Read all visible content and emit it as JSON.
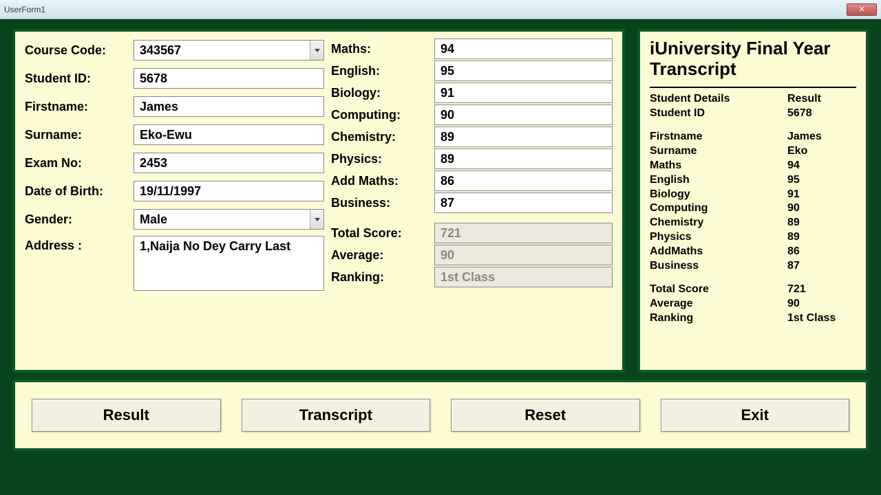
{
  "window": {
    "title": "UserForm1",
    "close": "✕"
  },
  "left": {
    "course_code_label": "Course Code:",
    "course_code": "343567",
    "student_id_label": "Student ID:",
    "student_id": "5678",
    "firstname_label": "Firstname:",
    "firstname": "James",
    "surname_label": "Surname:",
    "surname": "Eko-Ewu",
    "exam_no_label": "Exam No:",
    "exam_no": "2453",
    "dob_label": "Date of Birth:",
    "dob": "19/11/1997",
    "gender_label": "Gender:",
    "gender": "Male",
    "address_label": "Address :",
    "address": "1,Naija No Dey Carry Last"
  },
  "scores": {
    "maths_label": "Maths:",
    "maths": "94",
    "english_label": "English:",
    "english": "95",
    "biology_label": "Biology:",
    "biology": "91",
    "computing_label": "Computing:",
    "computing": "90",
    "chemistry_label": "Chemistry:",
    "chemistry": "89",
    "physics_label": "Physics:",
    "physics": "89",
    "addmaths_label": "Add Maths:",
    "addmaths": "86",
    "business_label": "Business:",
    "business": "87",
    "total_label": "Total Score:",
    "total": "721",
    "average_label": "Average:",
    "average": "90",
    "ranking_label": "Ranking:",
    "ranking": "1st Class"
  },
  "transcript": {
    "title": "iUniversity Final Year Transcript",
    "header_left": "Student Details",
    "header_right": "Result",
    "rows": {
      "student_id_k": "Student ID",
      "student_id_v": "5678",
      "firstname_k": "Firstname",
      "firstname_v": "James",
      "surname_k": "Surname",
      "surname_v": "Eko",
      "maths_k": "Maths",
      "maths_v": "94",
      "english_k": "English",
      "english_v": "95",
      "biology_k": "Biology",
      "biology_v": "91",
      "computing_k": "Computing",
      "computing_v": "90",
      "chemistry_k": "Chemistry",
      "chemistry_v": "89",
      "physics_k": "Physics",
      "physics_v": "89",
      "addmaths_k": "AddMaths",
      "addmaths_v": "86",
      "business_k": "Business",
      "business_v": "87",
      "total_k": "Total Score",
      "total_v": "721",
      "average_k": "Average",
      "average_v": "90",
      "ranking_k": "Ranking",
      "ranking_v": "1st Class"
    }
  },
  "buttons": {
    "result": "Result",
    "transcript": "Transcript",
    "reset": "Reset",
    "exit": "Exit"
  }
}
